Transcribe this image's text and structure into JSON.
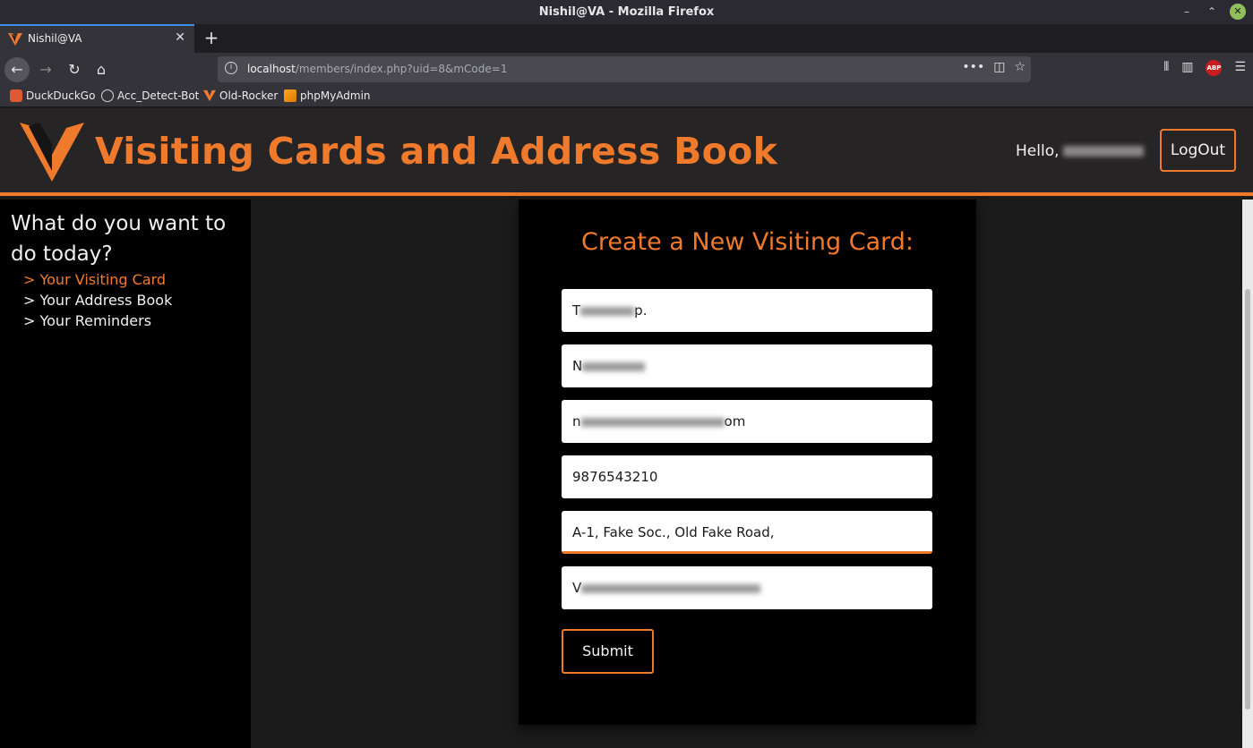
{
  "window": {
    "title": "Nishil@VA - Mozilla Firefox"
  },
  "tab": {
    "label": "Nishil@VA"
  },
  "urlbar": {
    "host": "localhost",
    "path": "/members/index.php?uid=8&mCode=1"
  },
  "bookmarks": [
    {
      "label": "DuckDuckGo",
      "icon": "duckduckgo-icon"
    },
    {
      "label": "Acc_Detect-Bot",
      "icon": "globe-icon"
    },
    {
      "label": "Old-Rocker",
      "icon": "va-logo-icon"
    },
    {
      "label": "phpMyAdmin",
      "icon": "phpmyadmin-icon"
    }
  ],
  "header": {
    "title": "Visiting Cards and Address Book",
    "greeting": "Hello,",
    "logout_label": "LogOut",
    "accent": "#f07a2c"
  },
  "sidebar": {
    "question": "What do you want to do today?",
    "links": [
      {
        "label": "> Your Visiting Card",
        "active": true
      },
      {
        "label": "> Your Address Book",
        "active": false
      },
      {
        "label": "> Your Reminders",
        "active": false
      }
    ]
  },
  "form": {
    "title": "Create a New Visiting Card:",
    "fields": [
      {
        "name": "company",
        "visible_start": "T",
        "visible_end": "p."
      },
      {
        "name": "person",
        "visible_start": "N",
        "visible_end": ""
      },
      {
        "name": "email",
        "visible_start": "n",
        "visible_end": "om"
      },
      {
        "name": "phone",
        "value": "9876543210"
      },
      {
        "name": "address1",
        "value": "A-1, Fake Soc., Old Fake Road,"
      },
      {
        "name": "address2",
        "visible_start": "V",
        "visible_end": ""
      }
    ],
    "submit_label": "Submit"
  }
}
